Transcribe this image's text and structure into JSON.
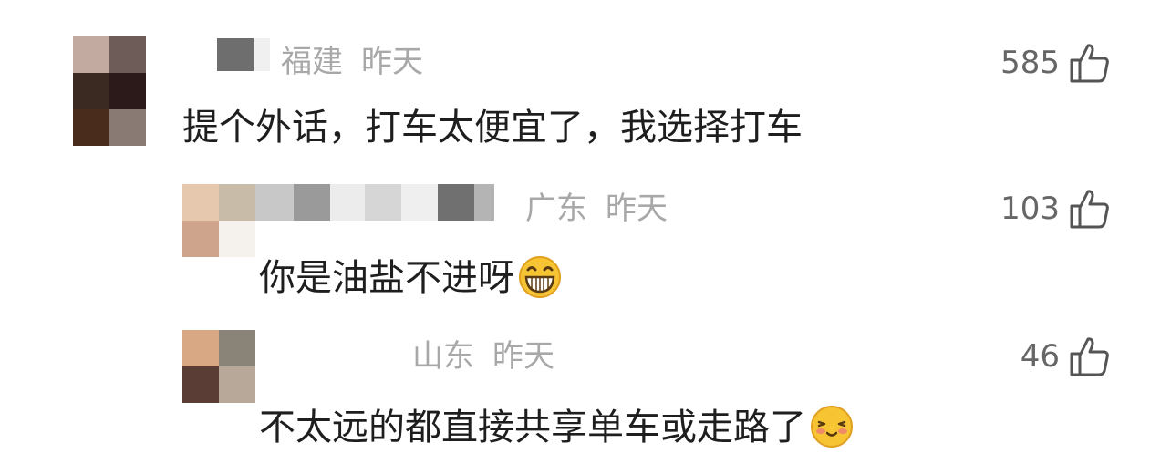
{
  "comments": [
    {
      "location": "福建",
      "time": "昨天",
      "text": "提个外话，打车太便宜了，我选择打车",
      "likes": "585",
      "avatar_colors": [
        "#c2aaa0",
        "#6d5c58",
        "#3a2a22",
        "#2c1a1a",
        "#4a2c1c",
        "#8a7a74"
      ]
    },
    {
      "location": "广东",
      "time": "昨天",
      "text": "你是油盐不进呀",
      "emoji": "grinning-face-icon",
      "likes": "103",
      "avatar_colors": [
        "#e6c8ae",
        "#c8bba8",
        "#cfa48c",
        "#f5f1ec"
      ]
    },
    {
      "location": "山东",
      "time": "昨天",
      "text": "不太远的都直接共享单车或走路了",
      "emoji": "blushing-face-icon",
      "likes": "46",
      "avatar_colors": [
        "#d8a884",
        "#8a8478",
        "#5a3e36",
        "#b8a89a"
      ]
    }
  ],
  "colors": {
    "meta": "#a8a8a8",
    "text": "#1e1e1e",
    "likes": "#666666",
    "emoji_yellow": "#f7c533",
    "emoji_outline": "#e0a020"
  }
}
